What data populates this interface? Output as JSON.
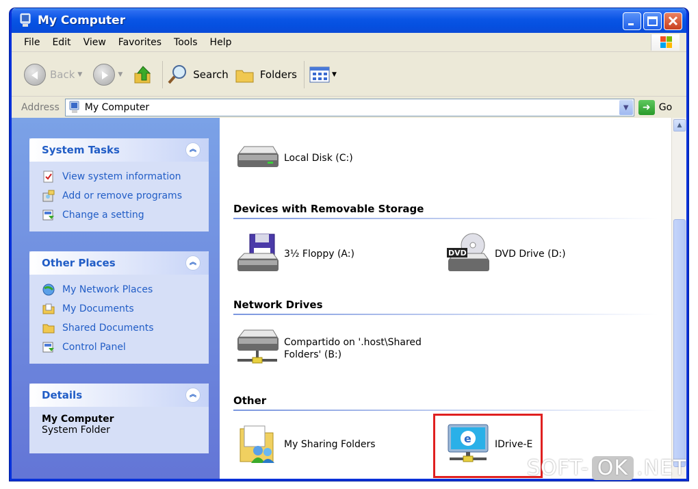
{
  "window": {
    "title": "My Computer"
  },
  "menu": [
    "File",
    "Edit",
    "View",
    "Favorites",
    "Tools",
    "Help"
  ],
  "toolbar": {
    "back": "Back",
    "search": "Search",
    "folders": "Folders"
  },
  "address": {
    "label": "Address",
    "value": "My Computer",
    "go": "Go"
  },
  "system_tasks": {
    "title": "System Tasks",
    "items": [
      "View system information",
      "Add or remove programs",
      "Change a setting"
    ]
  },
  "other_places": {
    "title": "Other Places",
    "items": [
      "My Network Places",
      "My Documents",
      "Shared Documents",
      "Control Panel"
    ]
  },
  "details": {
    "title": "Details",
    "name": "My Computer",
    "type": "System Folder"
  },
  "content": {
    "local_disk": "Local Disk (C:)",
    "removable": {
      "header": "Devices with Removable Storage",
      "floppy": "3½ Floppy (A:)",
      "dvd": "DVD Drive (D:)",
      "dvd_badge": "DVD"
    },
    "network": {
      "header": "Network Drives",
      "line1": "Compartido on '.host\\Shared",
      "line2": "Folders' (B:)"
    },
    "other": {
      "header": "Other",
      "sharing": "My Sharing Folders",
      "idrive": "IDrive-E",
      "idrive_glyph": "e"
    }
  },
  "watermark": {
    "left": "SOFT-",
    "ok": "OK",
    "right": ".NET"
  },
  "colors": {
    "title_blue": "#0A55E5",
    "link_blue": "#215DC6",
    "highlight_red": "#E02020"
  }
}
